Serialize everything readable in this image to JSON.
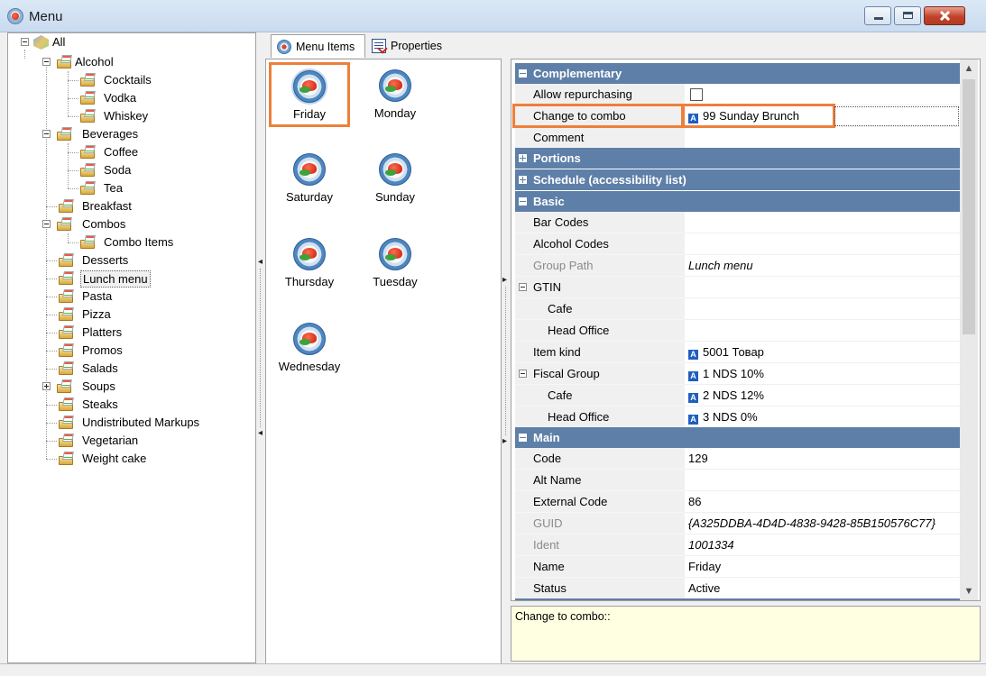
{
  "window": {
    "title": "Menu"
  },
  "tree": {
    "root": "All",
    "nodes": [
      {
        "label": "Alcohol",
        "level": 1,
        "expander": "minus"
      },
      {
        "label": "Cocktails",
        "level": 2
      },
      {
        "label": "Vodka",
        "level": 2
      },
      {
        "label": "Whiskey",
        "level": 2
      },
      {
        "label": "Beverages",
        "level": 1,
        "expander": "minus"
      },
      {
        "label": "Coffee",
        "level": 2
      },
      {
        "label": "Soda",
        "level": 2
      },
      {
        "label": "Tea",
        "level": 2
      },
      {
        "label": "Breakfast",
        "level": 1
      },
      {
        "label": "Combos",
        "level": 1,
        "expander": "minus"
      },
      {
        "label": "Combo Items",
        "level": 2
      },
      {
        "label": "Desserts",
        "level": 1
      },
      {
        "label": "Lunch menu",
        "level": 1,
        "selected": true
      },
      {
        "label": "Pasta",
        "level": 1
      },
      {
        "label": "Pizza",
        "level": 1
      },
      {
        "label": "Platters",
        "level": 1
      },
      {
        "label": "Promos",
        "level": 1
      },
      {
        "label": "Salads",
        "level": 1
      },
      {
        "label": "Soups",
        "level": 1,
        "expander": "plus"
      },
      {
        "label": "Steaks",
        "level": 1
      },
      {
        "label": "Undistributed Markups",
        "level": 1
      },
      {
        "label": "Vegetarian",
        "level": 1
      },
      {
        "label": "Weight cake",
        "level": 1
      }
    ]
  },
  "tabs": [
    {
      "label": "Menu Items",
      "active": true,
      "icon": "menu-icon"
    },
    {
      "label": "Properties",
      "active": false,
      "icon": "properties-icon"
    }
  ],
  "menu_items": [
    {
      "label": "Friday",
      "selected": true
    },
    {
      "label": "Monday"
    },
    {
      "label": "Saturday"
    },
    {
      "label": "Sunday"
    },
    {
      "label": "Thursday"
    },
    {
      "label": "Tuesday"
    },
    {
      "label": "Wednesday"
    }
  ],
  "properties": {
    "complementary": {
      "title": "Complementary",
      "allow_repurchasing": {
        "name": "Allow repurchasing",
        "checked": false
      },
      "change_to_combo": {
        "name": "Change to combo",
        "value": "99 Sunday Brunch"
      },
      "comment": {
        "name": "Comment",
        "value": ""
      }
    },
    "portions": {
      "title": "Portions"
    },
    "schedule": {
      "title": "Schedule (accessibility list)"
    },
    "basic": {
      "title": "Basic",
      "bar_codes": {
        "name": "Bar Codes",
        "value": ""
      },
      "alcohol_codes": {
        "name": "Alcohol Codes",
        "value": ""
      },
      "group_path": {
        "name": "Group Path",
        "value": "Lunch menu"
      },
      "gtin": {
        "name": "GTIN",
        "value": ""
      },
      "gtin_cafe": {
        "name": "Cafe",
        "value": ""
      },
      "gtin_head_office": {
        "name": "Head Office",
        "value": ""
      },
      "item_kind": {
        "name": "Item kind",
        "value": "5001 Товар"
      },
      "fiscal_group": {
        "name": "Fiscal Group",
        "value": "1 NDS 10%"
      },
      "fiscal_cafe": {
        "name": "Cafe",
        "value": "2 NDS 12%"
      },
      "fiscal_head_office": {
        "name": "Head Office",
        "value": "3 NDS 0%"
      }
    },
    "main": {
      "title": "Main",
      "code": {
        "name": "Code",
        "value": "129"
      },
      "alt_name": {
        "name": "Alt Name",
        "value": ""
      },
      "external_code": {
        "name": "External Code",
        "value": "86"
      },
      "guid": {
        "name": "GUID",
        "value": "{A325DDBA-4D4D-4838-9428-85B150576C77}"
      },
      "ident": {
        "name": "Ident",
        "value": "1001334"
      },
      "name": {
        "name": "Name",
        "value": "Friday"
      },
      "status": {
        "name": "Status",
        "value": "Active"
      }
    }
  },
  "description": {
    "text": "Change to combo::"
  },
  "icons": {
    "reference_badge": "A",
    "highlight_color": "#ee7f3a",
    "section_color": "#5e7fa8"
  }
}
